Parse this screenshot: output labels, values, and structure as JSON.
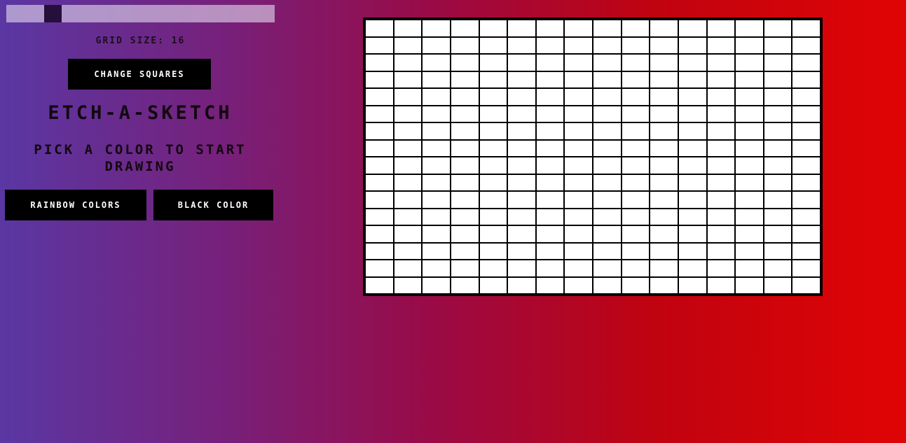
{
  "slider": {
    "value": 16,
    "min": 1,
    "max": 100
  },
  "grid_size": {
    "label": "GRID SIZE: 16",
    "rows": 16,
    "columns": 16
  },
  "buttons": {
    "change_squares": "CHANGE SQUARES",
    "rainbow_colors": "RAINBOW COLORS",
    "black_color": "BLACK COLOR"
  },
  "title": "ETCH-A-SKETCH",
  "instructions": "PICK A COLOR TO START DRAWING",
  "colors": {
    "background_left": "#5a37a3",
    "background_right": "#e00404",
    "cell": "#ffffff",
    "grid_line": "#000000"
  }
}
